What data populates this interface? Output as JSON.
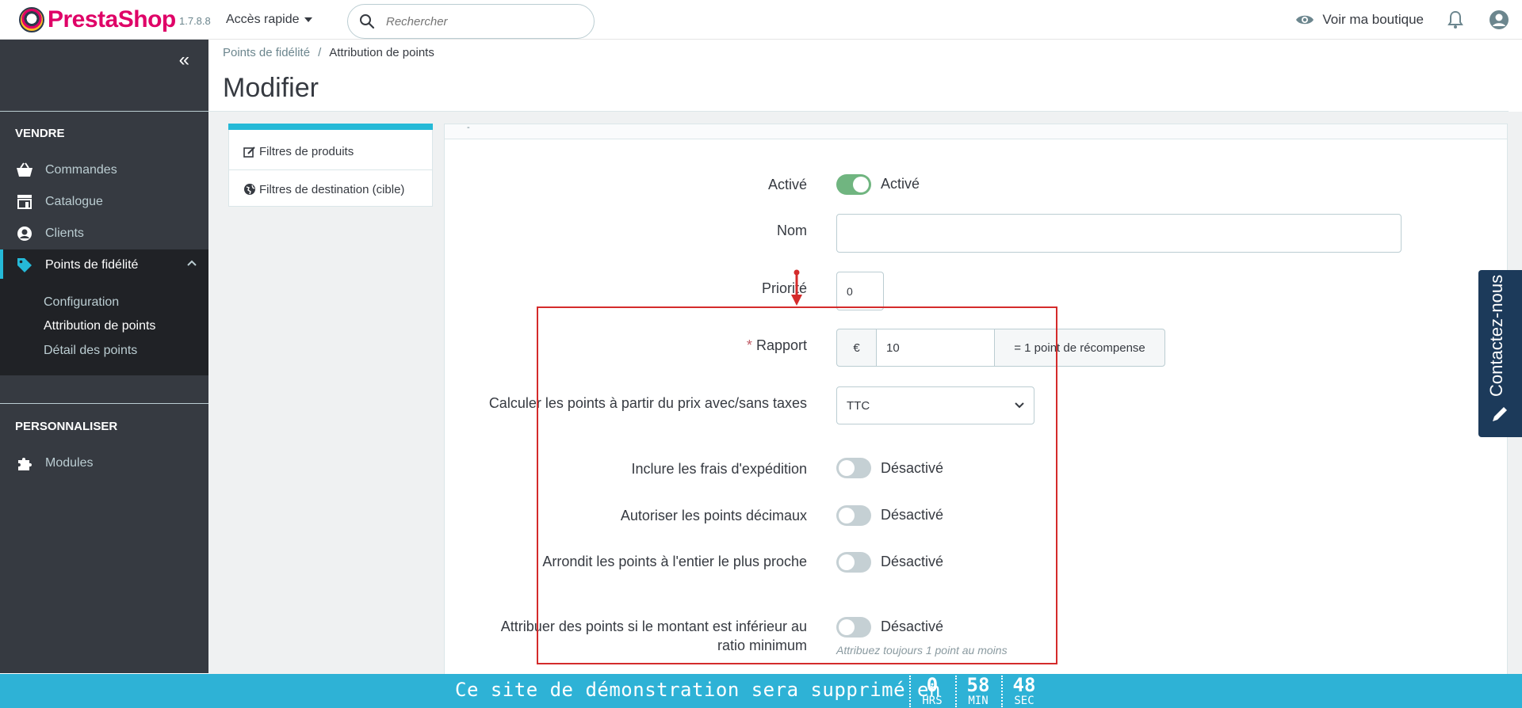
{
  "header": {
    "brand": "PrestaShop",
    "version": "1.7.8.8",
    "quick_access": "Accès rapide",
    "search_placeholder": "Rechercher",
    "view_shop": "Voir ma boutique"
  },
  "sidebar": {
    "section_sell": "VENDRE",
    "items": [
      {
        "label": "Commandes",
        "icon": "basket-icon"
      },
      {
        "label": "Catalogue",
        "icon": "store-icon"
      },
      {
        "label": "Clients",
        "icon": "user-circle-icon"
      },
      {
        "label": "Points de fidélité",
        "icon": "tag-icon"
      }
    ],
    "sub_items": [
      {
        "label": "Configuration"
      },
      {
        "label": "Attribution de points"
      },
      {
        "label": "Détail des points"
      }
    ],
    "section_customize": "PERSONNALISER",
    "modules": "Modules"
  },
  "breadcrumb": {
    "parent": "Points de fidélité",
    "separator": "/",
    "current": "Attribution de points"
  },
  "page_title": "Modifier",
  "left_panel": {
    "product_filters": "Filtres de produits",
    "destination_filters": "Filtres de destination (cible)"
  },
  "form": {
    "panel_head": "-",
    "active_label": "Activé",
    "active_state": "Activé",
    "name_label": "Nom",
    "name_value": "",
    "priority_label": "Priorité",
    "priority_value": "0",
    "ratio_required": "*",
    "ratio_label": "Rapport",
    "ratio_currency": "€",
    "ratio_value": "10",
    "ratio_suffix": "= 1 point de récompense",
    "tax_label": "Calculer les points à partir du prix avec/sans taxes",
    "tax_value": "TTC",
    "shipping_label": "Inclure les frais d'expédition",
    "shipping_state": "Désactivé",
    "decimal_label": "Autoriser les points décimaux",
    "decimal_state": "Désactivé",
    "round_label": "Arrondit les points à l'entier le plus proche",
    "round_state": "Désactivé",
    "minimum_label": "Attribuer des points si le montant est inférieur au ratio minimum",
    "minimum_state": "Désactivé",
    "minimum_help": "Attribuez toujours 1 point au moins"
  },
  "contact_tab": "Contactez-nous",
  "banner": {
    "text": "Ce site de démonstration sera supprimé en",
    "hours": "0",
    "hours_unit": "HRS",
    "minutes": "58",
    "minutes_unit": "MIN",
    "seconds": "48",
    "seconds_unit": "SEC"
  },
  "colors": {
    "accent": "#25b9d7",
    "sidebar": "#363a41",
    "brand": "#df0067",
    "switch_on": "#70b580",
    "highlight": "#d42b2b"
  }
}
